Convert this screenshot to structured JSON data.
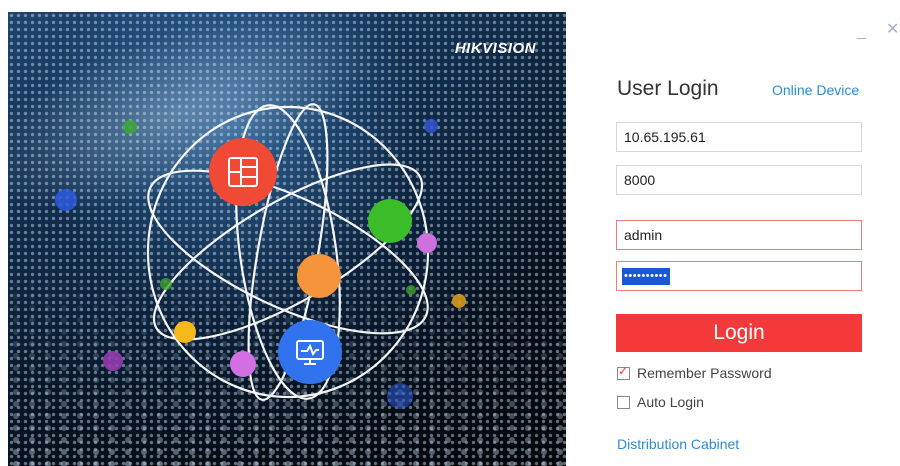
{
  "brand": "HIKVISION",
  "window": {
    "minimize_symbol": "_",
    "close_symbol": "✕"
  },
  "login": {
    "title": "User Login",
    "online_device_link": "Online Device",
    "ip_value": "10.65.195.61",
    "port_value": "8000",
    "username_value": "admin",
    "password_mask": "••••••••••",
    "login_button": "Login",
    "remember_password": {
      "label": "Remember Password",
      "checked": true,
      "symbol": "✓"
    },
    "auto_login": {
      "label": "Auto Login",
      "checked": false
    },
    "distribution_cabinet_link": "Distribution Cabinet"
  },
  "icons": {
    "hero_nodes": [
      "layout-grid-icon",
      "monitor-icon"
    ]
  },
  "colors": {
    "accent_red": "#f4393b",
    "link_blue": "#2b8bd6",
    "error_border": "#f07a7a"
  }
}
